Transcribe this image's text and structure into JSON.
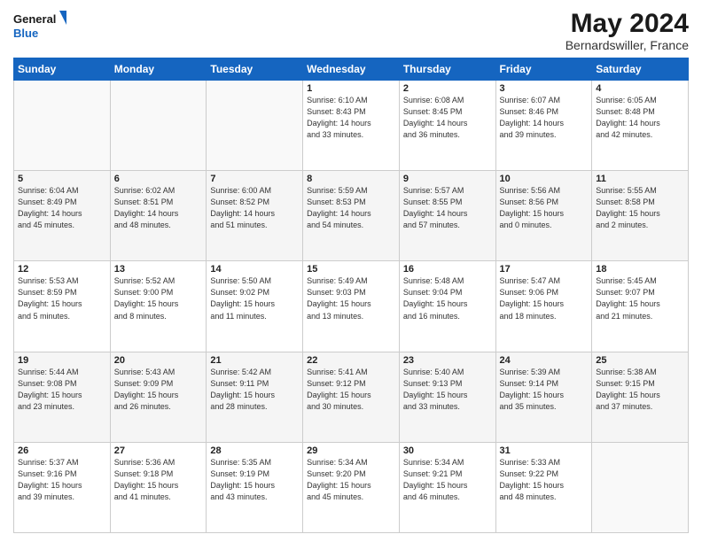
{
  "header": {
    "logo_line1": "General",
    "logo_line2": "Blue",
    "main_title": "May 2024",
    "subtitle": "Bernardswiller, France"
  },
  "days_of_week": [
    "Sunday",
    "Monday",
    "Tuesday",
    "Wednesday",
    "Thursday",
    "Friday",
    "Saturday"
  ],
  "weeks": [
    [
      {
        "day": "",
        "info": ""
      },
      {
        "day": "",
        "info": ""
      },
      {
        "day": "",
        "info": ""
      },
      {
        "day": "1",
        "info": "Sunrise: 6:10 AM\nSunset: 8:43 PM\nDaylight: 14 hours\nand 33 minutes."
      },
      {
        "day": "2",
        "info": "Sunrise: 6:08 AM\nSunset: 8:45 PM\nDaylight: 14 hours\nand 36 minutes."
      },
      {
        "day": "3",
        "info": "Sunrise: 6:07 AM\nSunset: 8:46 PM\nDaylight: 14 hours\nand 39 minutes."
      },
      {
        "day": "4",
        "info": "Sunrise: 6:05 AM\nSunset: 8:48 PM\nDaylight: 14 hours\nand 42 minutes."
      }
    ],
    [
      {
        "day": "5",
        "info": "Sunrise: 6:04 AM\nSunset: 8:49 PM\nDaylight: 14 hours\nand 45 minutes."
      },
      {
        "day": "6",
        "info": "Sunrise: 6:02 AM\nSunset: 8:51 PM\nDaylight: 14 hours\nand 48 minutes."
      },
      {
        "day": "7",
        "info": "Sunrise: 6:00 AM\nSunset: 8:52 PM\nDaylight: 14 hours\nand 51 minutes."
      },
      {
        "day": "8",
        "info": "Sunrise: 5:59 AM\nSunset: 8:53 PM\nDaylight: 14 hours\nand 54 minutes."
      },
      {
        "day": "9",
        "info": "Sunrise: 5:57 AM\nSunset: 8:55 PM\nDaylight: 14 hours\nand 57 minutes."
      },
      {
        "day": "10",
        "info": "Sunrise: 5:56 AM\nSunset: 8:56 PM\nDaylight: 15 hours\nand 0 minutes."
      },
      {
        "day": "11",
        "info": "Sunrise: 5:55 AM\nSunset: 8:58 PM\nDaylight: 15 hours\nand 2 minutes."
      }
    ],
    [
      {
        "day": "12",
        "info": "Sunrise: 5:53 AM\nSunset: 8:59 PM\nDaylight: 15 hours\nand 5 minutes."
      },
      {
        "day": "13",
        "info": "Sunrise: 5:52 AM\nSunset: 9:00 PM\nDaylight: 15 hours\nand 8 minutes."
      },
      {
        "day": "14",
        "info": "Sunrise: 5:50 AM\nSunset: 9:02 PM\nDaylight: 15 hours\nand 11 minutes."
      },
      {
        "day": "15",
        "info": "Sunrise: 5:49 AM\nSunset: 9:03 PM\nDaylight: 15 hours\nand 13 minutes."
      },
      {
        "day": "16",
        "info": "Sunrise: 5:48 AM\nSunset: 9:04 PM\nDaylight: 15 hours\nand 16 minutes."
      },
      {
        "day": "17",
        "info": "Sunrise: 5:47 AM\nSunset: 9:06 PM\nDaylight: 15 hours\nand 18 minutes."
      },
      {
        "day": "18",
        "info": "Sunrise: 5:45 AM\nSunset: 9:07 PM\nDaylight: 15 hours\nand 21 minutes."
      }
    ],
    [
      {
        "day": "19",
        "info": "Sunrise: 5:44 AM\nSunset: 9:08 PM\nDaylight: 15 hours\nand 23 minutes."
      },
      {
        "day": "20",
        "info": "Sunrise: 5:43 AM\nSunset: 9:09 PM\nDaylight: 15 hours\nand 26 minutes."
      },
      {
        "day": "21",
        "info": "Sunrise: 5:42 AM\nSunset: 9:11 PM\nDaylight: 15 hours\nand 28 minutes."
      },
      {
        "day": "22",
        "info": "Sunrise: 5:41 AM\nSunset: 9:12 PM\nDaylight: 15 hours\nand 30 minutes."
      },
      {
        "day": "23",
        "info": "Sunrise: 5:40 AM\nSunset: 9:13 PM\nDaylight: 15 hours\nand 33 minutes."
      },
      {
        "day": "24",
        "info": "Sunrise: 5:39 AM\nSunset: 9:14 PM\nDaylight: 15 hours\nand 35 minutes."
      },
      {
        "day": "25",
        "info": "Sunrise: 5:38 AM\nSunset: 9:15 PM\nDaylight: 15 hours\nand 37 minutes."
      }
    ],
    [
      {
        "day": "26",
        "info": "Sunrise: 5:37 AM\nSunset: 9:16 PM\nDaylight: 15 hours\nand 39 minutes."
      },
      {
        "day": "27",
        "info": "Sunrise: 5:36 AM\nSunset: 9:18 PM\nDaylight: 15 hours\nand 41 minutes."
      },
      {
        "day": "28",
        "info": "Sunrise: 5:35 AM\nSunset: 9:19 PM\nDaylight: 15 hours\nand 43 minutes."
      },
      {
        "day": "29",
        "info": "Sunrise: 5:34 AM\nSunset: 9:20 PM\nDaylight: 15 hours\nand 45 minutes."
      },
      {
        "day": "30",
        "info": "Sunrise: 5:34 AM\nSunset: 9:21 PM\nDaylight: 15 hours\nand 46 minutes."
      },
      {
        "day": "31",
        "info": "Sunrise: 5:33 AM\nSunset: 9:22 PM\nDaylight: 15 hours\nand 48 minutes."
      },
      {
        "day": "",
        "info": ""
      }
    ]
  ]
}
